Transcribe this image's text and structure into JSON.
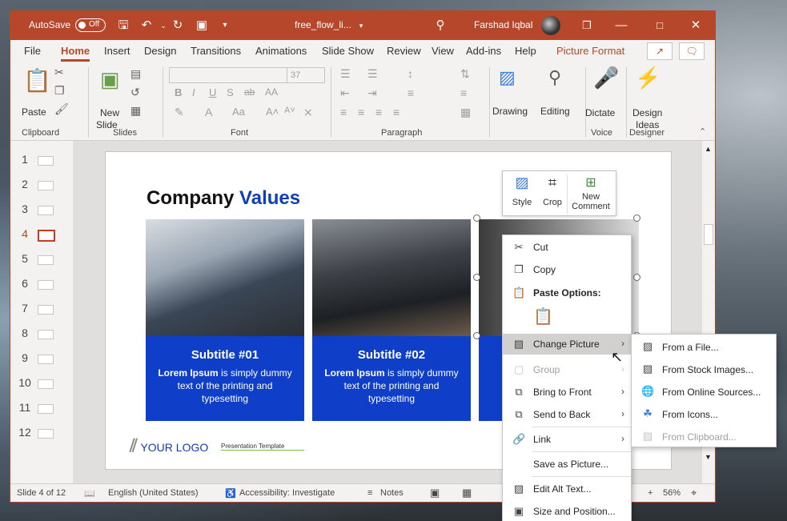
{
  "titlebar": {
    "autosave_label": "AutoSave",
    "autosave_state": "Off",
    "filename": "free_flow_li...",
    "user_name": "Farshad Iqbal"
  },
  "menu_tabs": [
    "File",
    "Home",
    "Insert",
    "Design",
    "Transitions",
    "Animations",
    "Slide Show",
    "Review",
    "View",
    "Add-ins",
    "Help",
    "Picture Format"
  ],
  "ribbon": {
    "clipboard": {
      "paste": "Paste",
      "label": "Clipboard"
    },
    "slides": {
      "new_slide_line1": "New",
      "new_slide_line2": "Slide",
      "label": "Slides"
    },
    "font": {
      "size": "37",
      "label": "Font",
      "buttons": [
        "B",
        "I",
        "U",
        "S",
        "ab",
        "AA"
      ]
    },
    "paragraph": {
      "label": "Paragraph"
    },
    "drawing": "Drawing",
    "editing": "Editing",
    "voice": {
      "dictate": "Dictate",
      "label": "Voice"
    },
    "designer": {
      "design_ideas_line1": "Design",
      "design_ideas_line2": "Ideas",
      "label": "Designer"
    }
  },
  "thumbnails": [
    "1",
    "2",
    "3",
    "4",
    "5",
    "6",
    "7",
    "8",
    "9",
    "10",
    "11",
    "12"
  ],
  "current_slide": "4",
  "slide": {
    "title_black": "Company",
    "title_blue": "Values",
    "cards": [
      {
        "subtitle": "Subtitle #01",
        "bold": "Lorem Ipsum",
        "rest": " is simply dummy text of the printing and typesetting"
      },
      {
        "subtitle": "Subtitle #02",
        "bold": "Lorem Ipsum",
        "rest": " is simply dummy text of the printing and typesetting"
      }
    ],
    "logo": "YOUR LOGO",
    "template": "Presentation Template"
  },
  "mini_toolbar": {
    "style": "Style",
    "crop": "Crop",
    "new_comment_line1": "New",
    "new_comment_line2": "Comment"
  },
  "context_menu": {
    "cut": "Cut",
    "copy": "Copy",
    "paste_options": "Paste Options:",
    "change_picture": "Change Picture",
    "group": "Group",
    "bring_to_front": "Bring to Front",
    "send_to_back": "Send to Back",
    "link": "Link",
    "save_as_picture": "Save as Picture...",
    "edit_alt_text": "Edit Alt Text...",
    "size_and_position": "Size and Position..."
  },
  "submenu": {
    "from_file": "From a File...",
    "from_stock": "From Stock Images...",
    "from_online": "From Online Sources...",
    "from_icons": "From Icons...",
    "from_clipboard": "From Clipboard..."
  },
  "statusbar": {
    "slide_info": "Slide 4 of 12",
    "language": "English (United States)",
    "accessibility": "Accessibility: Investigate",
    "notes": "Notes",
    "zoom": "56%"
  },
  "colors": {
    "accent": "#b7472a",
    "slide_blue": "#0f3fc9",
    "title_blue": "#0f3fb6"
  }
}
